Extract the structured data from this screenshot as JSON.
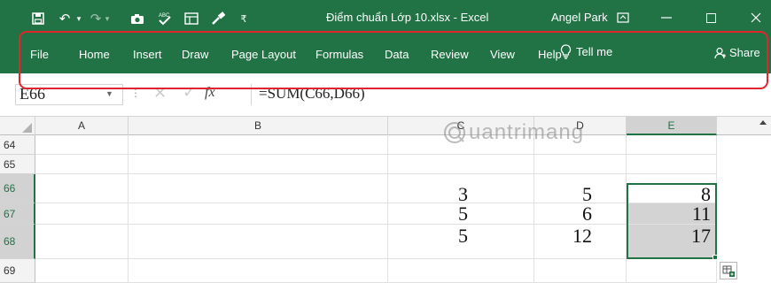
{
  "titlebar": {
    "document_title": "Điểm chuẩn Lớp 10.xlsx - Excel",
    "user_name": "Angel Park"
  },
  "ribbon": {
    "tabs": [
      "File",
      "Home",
      "Insert",
      "Draw",
      "Page Layout",
      "Formulas",
      "Data",
      "Review",
      "View",
      "Help"
    ],
    "tell_me": "Tell me",
    "share": "Share",
    "highlight_color": "#e0262c"
  },
  "formula_bar": {
    "name_box": "E66",
    "formula": "=SUM(C66,D66)"
  },
  "grid": {
    "columns": [
      "A",
      "B",
      "C",
      "D",
      "E"
    ],
    "active_column": "E",
    "rows": [
      {
        "row": "64",
        "cells": [
          "",
          "",
          "",
          "",
          ""
        ]
      },
      {
        "row": "65",
        "cells": [
          "",
          "",
          "",
          "",
          ""
        ]
      },
      {
        "row": "66",
        "cells": [
          "",
          "",
          "3",
          "5",
          "8"
        ]
      },
      {
        "row": "67",
        "cells": [
          "",
          "",
          "5",
          "6",
          "11"
        ]
      },
      {
        "row": "68",
        "cells": [
          "",
          "",
          "5",
          "12",
          "17"
        ]
      },
      {
        "row": "69",
        "cells": [
          "",
          "",
          "",
          "",
          ""
        ]
      }
    ]
  },
  "watermark": "uantrimang",
  "colors": {
    "excel_green": "#217346",
    "selection_fill": "#d3d3d3"
  }
}
